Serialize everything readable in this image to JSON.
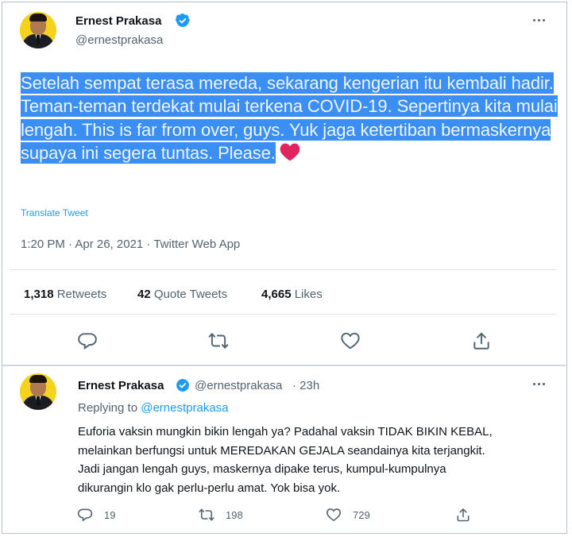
{
  "main_tweet": {
    "author_name": "Ernest Prakasa",
    "author_handle": "@ernestprakasa",
    "text": "Setelah sempat terasa mereda, sekarang kengerian itu kembali hadir. Teman-teman terdekat mulai terkena COVID-19. Sepertinya kita mulai lengah. This is far from over, guys. Yuk jaga ketertiban bermaskernya supaya ini segera tuntas. Please.",
    "emoji_icon": "heart-icon",
    "translate_label": "Translate Tweet",
    "meta": "1:20 PM · Apr 26, 2021 · Twitter Web App",
    "stats": {
      "retweets_count": "1,318",
      "retweets_label": "Retweets",
      "quote_count": "42",
      "quote_label": "Quote Tweets",
      "likes_count": "4,665",
      "likes_label": "Likes"
    }
  },
  "reply_tweet": {
    "author_name": "Ernest Prakasa",
    "author_handle": "@ernestprakasa",
    "time": "· 23h",
    "replying_label": "Replying to",
    "replying_handle": "@ernestprakasa",
    "lines": [
      "Euforia vaksin mungkin bikin lengah ya? Padahal vaksin TIDAK BIKIN KEBAL,",
      "melainkan berfungsi untuk MEREDAKAN GEJALA seandainya kita terjangkit.",
      "Jadi jangan lengah guys, maskernya dipake terus, kumpul-kumpulnya",
      "dikurangin klo gak perlu-perlu amat. Yok bisa yok."
    ],
    "reply_count": "19",
    "retweet_count": "198",
    "like_count": "729"
  },
  "colors": {
    "accent": "#1d9bf0",
    "highlight": "#3b8ff2",
    "muted": "#536471",
    "heart": "#e0245e"
  }
}
